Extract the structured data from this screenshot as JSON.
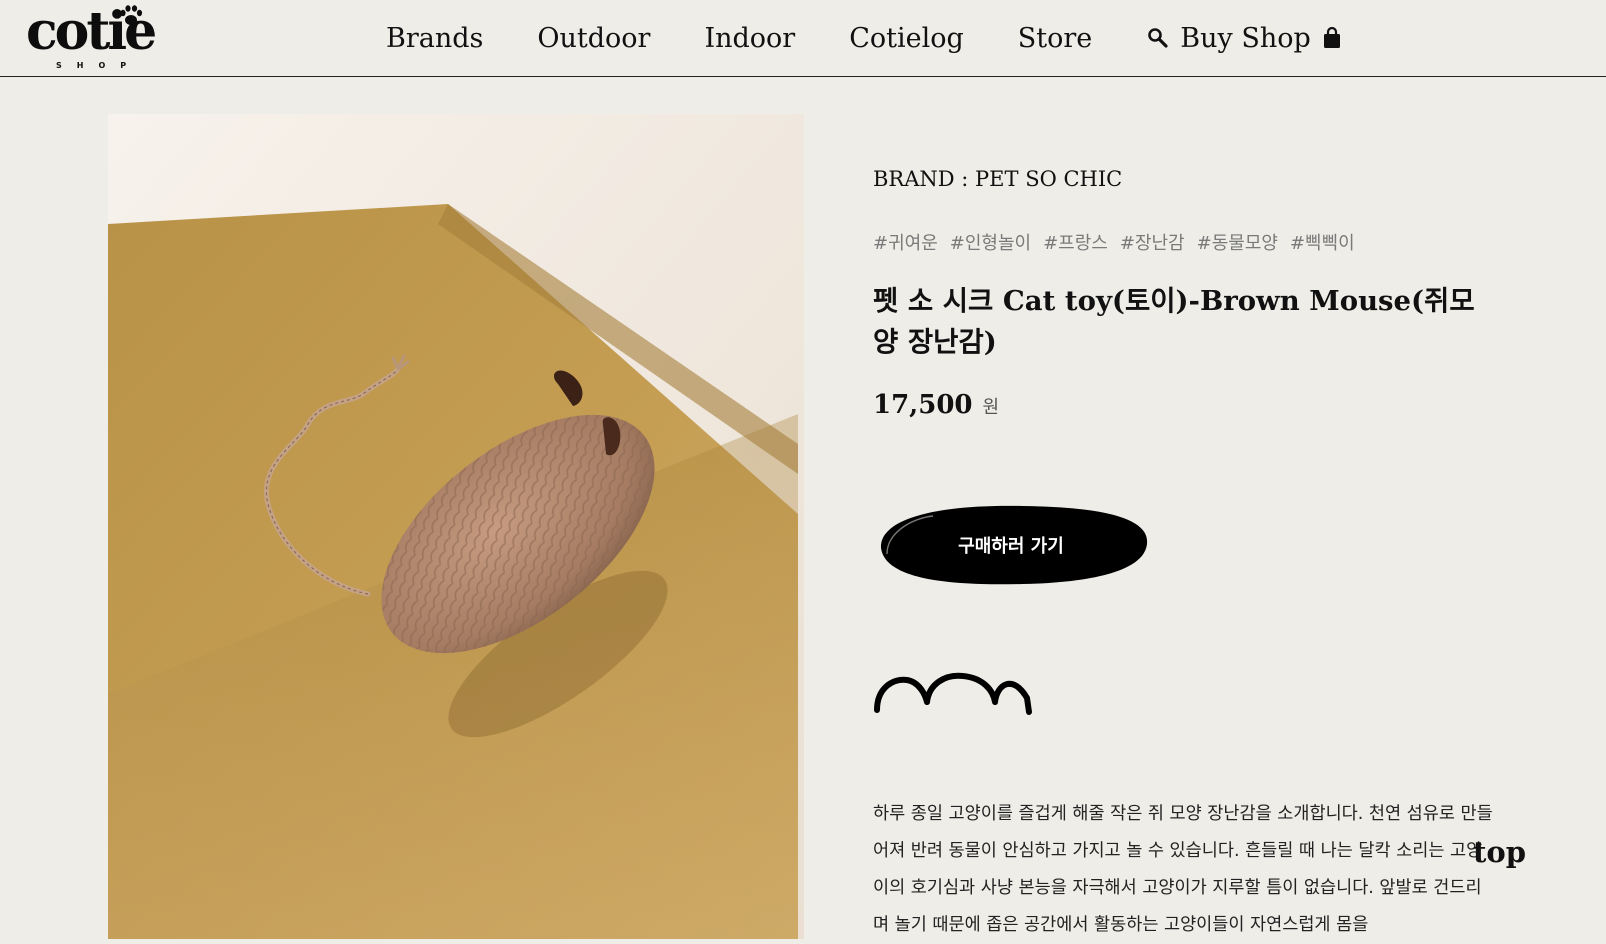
{
  "header": {
    "logo_text": "cotie",
    "logo_sub": "SHOP",
    "nav": [
      "Brands",
      "Outdoor",
      "Indoor",
      "Cotielog",
      "Store"
    ],
    "shop_label": "Buy Shop",
    "icons": {
      "search": "search-icon",
      "bag": "shopping-bag-icon"
    }
  },
  "product": {
    "brand": "BRAND : PET SO CHIC",
    "tags": [
      "#귀여운",
      "#인형놀이",
      "#프랑스",
      "#장난감",
      "#동물모양",
      "#삑삑이"
    ],
    "title": "펫 소 시크 Cat toy(토이)-Brown Mouse(쥐모양 장난감)",
    "price": "17,500",
    "currency": "원",
    "buy_label": "구매하러 가기",
    "description": "하루 종일 고양이를 즐겁게 해줄 작은 쥐 모양 장난감을 소개합니다. 천연 섬유로 만들 어져 반려 동물이 안심하고 가지고 놀 수 있습니다. 흔들릴 때 나는 달칵 소리는 고양 이의 호기심과 사냥 본능을 자극해서 고양이가 지루할 틈이 없습니다. 앞발로 건드리며 놀기 때문에 좁은 공간에서 활동하는 고양이들이 자연스럽게 몸을"
  },
  "top_label": "top",
  "colors": {
    "background": "#efede7",
    "text": "#111111",
    "tag": "#7a7a7a",
    "button": "#000000"
  }
}
